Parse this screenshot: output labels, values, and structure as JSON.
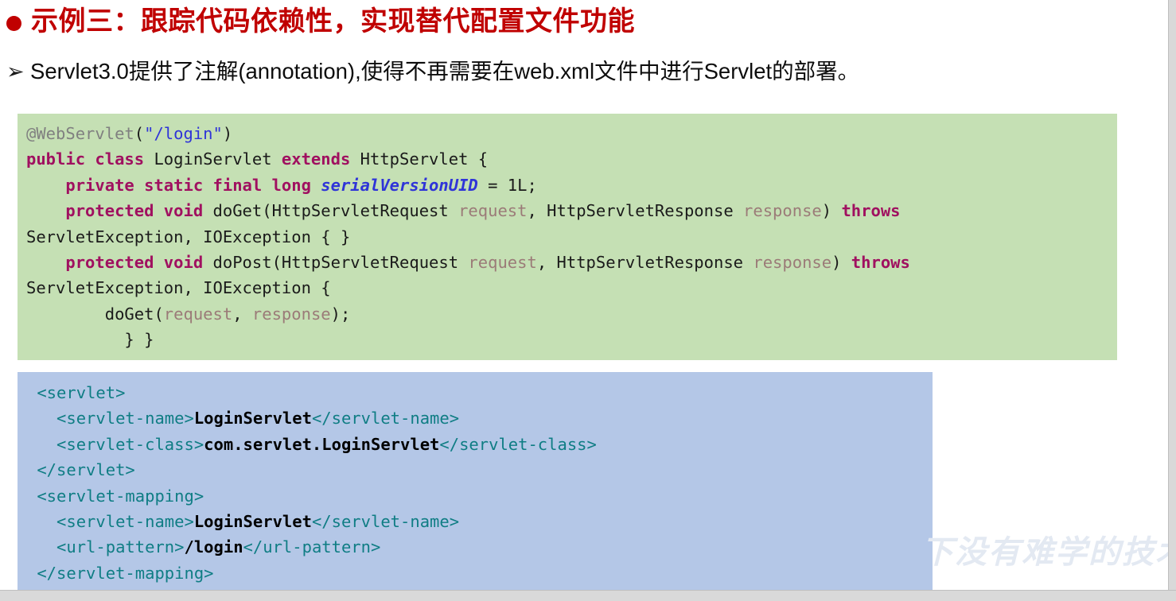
{
  "slide": {
    "heading": {
      "bullet_icon": "red-circle-bullet",
      "text": "示例三：跟踪代码依赖性，实现替代配置文件功能",
      "color": "#c00000"
    },
    "subline": {
      "marker_icon": "arrow-bullet",
      "marker_glyph": "➢",
      "text": "Servlet3.0提供了注解(annotation),使得不再需要在web.xml文件中进行Servlet的部署。"
    },
    "java_block": {
      "background_color": "#c5e0b4",
      "language": "java",
      "lines": [
        [
          {
            "t": "@WebServlet",
            "c": "anno"
          },
          {
            "t": "(",
            "c": "plain"
          },
          {
            "t": "\"/login\"",
            "c": "str"
          },
          {
            "t": ")",
            "c": "plain"
          }
        ],
        [
          {
            "t": "public class ",
            "c": "kw"
          },
          {
            "t": "LoginServlet ",
            "c": "plain"
          },
          {
            "t": "extends ",
            "c": "kw"
          },
          {
            "t": "HttpServlet {",
            "c": "plain"
          }
        ],
        [
          {
            "t": "    ",
            "c": "plain"
          },
          {
            "t": "private static final long ",
            "c": "kw"
          },
          {
            "t": "serialVersionUID",
            "c": "field"
          },
          {
            "t": " = 1L;",
            "c": "plain"
          }
        ],
        [
          {
            "t": "    ",
            "c": "plain"
          },
          {
            "t": "protected void ",
            "c": "kw"
          },
          {
            "t": "doGet(HttpServletRequest ",
            "c": "plain"
          },
          {
            "t": "request",
            "c": "param"
          },
          {
            "t": ", HttpServletResponse ",
            "c": "plain"
          },
          {
            "t": "response",
            "c": "param"
          },
          {
            "t": ") ",
            "c": "plain"
          },
          {
            "t": "throws",
            "c": "kw"
          }
        ],
        [
          {
            "t": "ServletException, IOException { }",
            "c": "plain"
          }
        ],
        [
          {
            "t": "    ",
            "c": "plain"
          },
          {
            "t": "protected void ",
            "c": "kw"
          },
          {
            "t": "doPost(HttpServletRequest ",
            "c": "plain"
          },
          {
            "t": "request",
            "c": "param"
          },
          {
            "t": ", HttpServletResponse ",
            "c": "plain"
          },
          {
            "t": "response",
            "c": "param"
          },
          {
            "t": ") ",
            "c": "plain"
          },
          {
            "t": "throws",
            "c": "kw"
          }
        ],
        [
          {
            "t": "ServletException, IOException {",
            "c": "plain"
          }
        ],
        [
          {
            "t": "        doGet(",
            "c": "plain"
          },
          {
            "t": "request",
            "c": "param"
          },
          {
            "t": ", ",
            "c": "plain"
          },
          {
            "t": "response",
            "c": "param"
          },
          {
            "t": ");",
            "c": "plain"
          }
        ],
        [
          {
            "t": "          } }",
            "c": "plain"
          }
        ]
      ]
    },
    "xml_block": {
      "background_color": "#b4c7e7",
      "language": "xml",
      "lines": [
        [
          {
            "t": " <servlet>",
            "c": "tag"
          }
        ],
        [
          {
            "t": "   <servlet-name>",
            "c": "tag"
          },
          {
            "t": "LoginServlet",
            "c": "val"
          },
          {
            "t": "</servlet-name>",
            "c": "tag"
          }
        ],
        [
          {
            "t": "   <servlet-class>",
            "c": "tag"
          },
          {
            "t": "com.servlet.LoginServlet",
            "c": "val"
          },
          {
            "t": "</servlet-class>",
            "c": "tag"
          }
        ],
        [
          {
            "t": " </servlet>",
            "c": "tag"
          }
        ],
        [
          {
            "t": " <servlet-mapping>",
            "c": "tag"
          }
        ],
        [
          {
            "t": "   <servlet-name>",
            "c": "tag"
          },
          {
            "t": "LoginServlet",
            "c": "val"
          },
          {
            "t": "</servlet-name>",
            "c": "tag"
          }
        ],
        [
          {
            "t": "   <url-pattern>",
            "c": "tag"
          },
          {
            "t": "/login",
            "c": "val"
          },
          {
            "t": "</url-pattern>",
            "c": "tag"
          }
        ],
        [
          {
            "t": " </servlet-mapping>",
            "c": "tag"
          }
        ]
      ]
    },
    "watermark": {
      "text": "下没有难学的技术"
    }
  }
}
